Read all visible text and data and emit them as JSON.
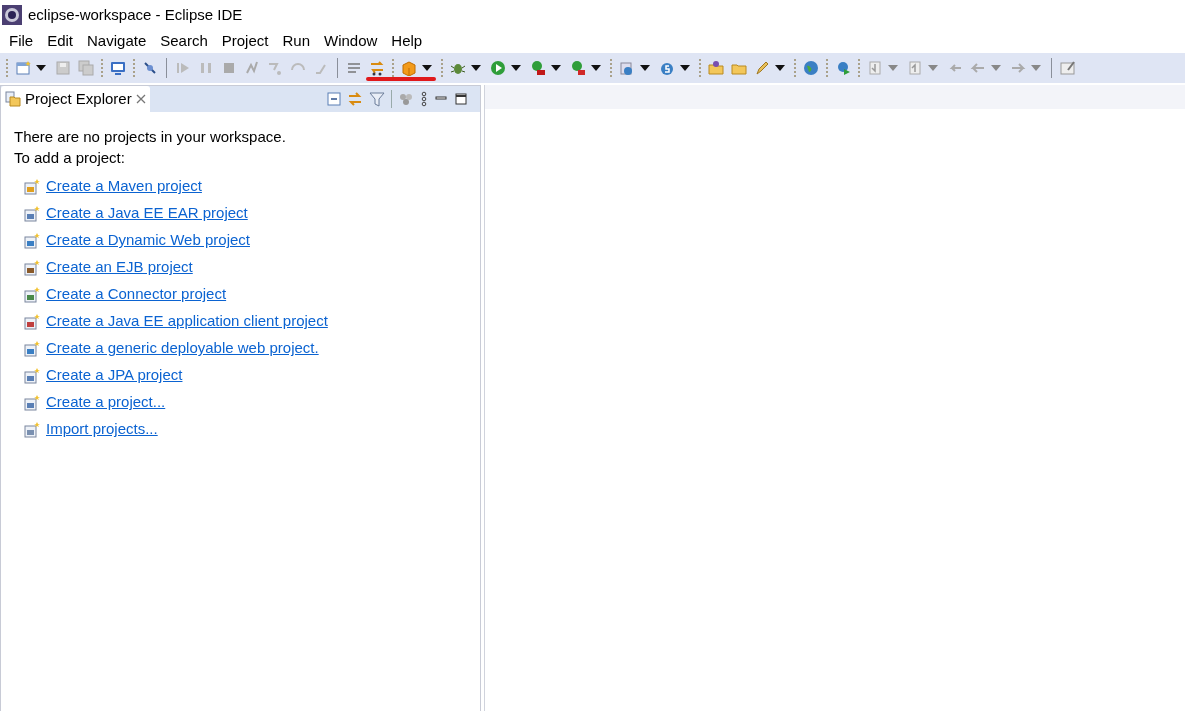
{
  "window": {
    "title": "eclipse-workspace - Eclipse IDE"
  },
  "menu": [
    "File",
    "Edit",
    "Navigate",
    "Search",
    "Project",
    "Run",
    "Window",
    "Help"
  ],
  "project_explorer": {
    "tab_title": "Project Explorer",
    "message_lines": [
      "There are no projects in your workspace.",
      "To add a project:"
    ],
    "links": [
      "Create a Maven project",
      "Create a Java EE EAR project",
      "Create a Dynamic Web project",
      "Create an EJB project",
      "Create a Connector project",
      "Create a Java EE application client project",
      "Create a generic deployable web project.",
      "Create a JPA project",
      "Create a project...",
      "Import projects..."
    ]
  }
}
